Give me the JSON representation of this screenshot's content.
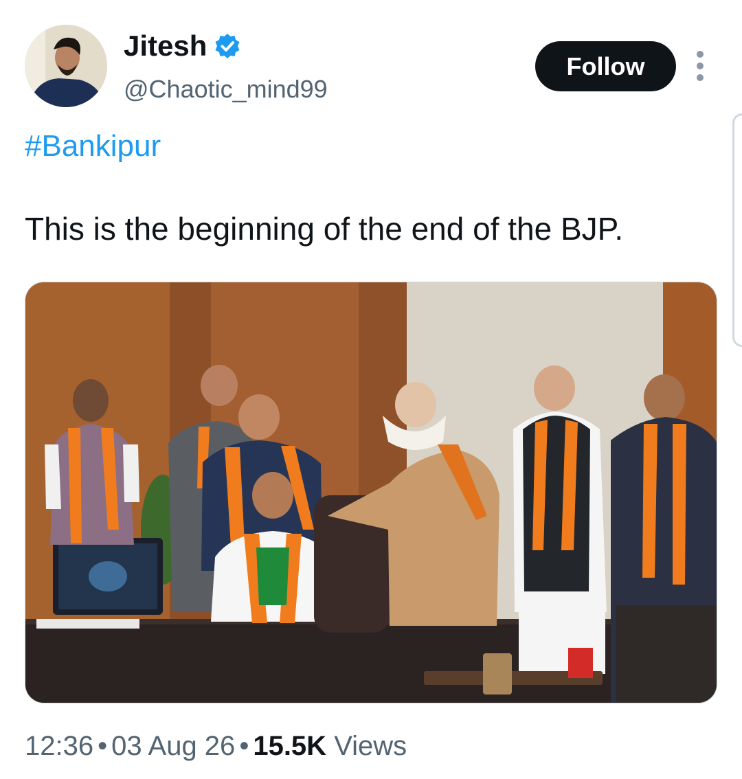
{
  "author": {
    "name": "Jitesh",
    "handle": "@Chaotic_mind99",
    "verified": true,
    "avatar_icon": "profile-photo"
  },
  "actions": {
    "follow_label": "Follow",
    "more_icon": "more-vertical-icon"
  },
  "tweet": {
    "hashtag": "#Bankipur",
    "text": "This is the beginning of the end of the BJP.",
    "media": {
      "description_icon": "photo"
    }
  },
  "meta": {
    "time": "12:36",
    "date": "03 Aug 26",
    "views_count": "15.5K",
    "views_label": "Views",
    "separator": "•"
  },
  "colors": {
    "link": "#1d9bf0",
    "follow_bg": "#0f1419",
    "secondary_text": "#536471",
    "saffron": "#f07c1e",
    "green": "#1e8a3a"
  }
}
